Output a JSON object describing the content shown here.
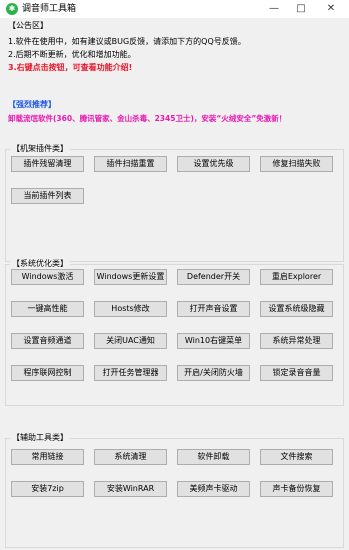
{
  "window": {
    "title": "调音师工具箱",
    "icon_glyph": "✱",
    "minimize": "—",
    "maximize": "□",
    "close": "✕"
  },
  "notice": {
    "header": "【公告区】",
    "line1": "1.软件在使用中，如有建议或BUG反馈，请添加下方的QQ号反馈。",
    "line2": "2.后期不断更新，优化和增加功能。",
    "line3": "3.右键点击按钮，可查看功能介绍!",
    "recommend_header": "【强烈推荐】",
    "recommend_text": "卸载流氓软件(360、腾讯管家、金山杀毒、2345卫士)，安装“火绒安全”免激新！"
  },
  "plugins": {
    "title": "【机架插件类】",
    "buttons": [
      "插件残留清理",
      "插件扫描重置",
      "设置优先级",
      "修复扫描失败",
      "当前插件列表"
    ]
  },
  "system": {
    "title": "【系统优化类】",
    "buttons": [
      "Windows激活",
      "Windows更新设置",
      "Defender开关",
      "重启Explorer",
      "一键高性能",
      "Hosts修改",
      "打开声音设置",
      "设置系统级隐藏",
      "设置音频通道",
      "关闭UAC通知",
      "Win10右键菜单",
      "系统异常处理",
      "程序联网控制",
      "打开任务管理器",
      "开启/关闭防火墙",
      "锁定录音音量"
    ]
  },
  "tools": {
    "title": "【辅助工具类】",
    "buttons": [
      "常用链接",
      "系统清理",
      "软件卸载",
      "文件搜索",
      "安装7zip",
      "安装WinRAR",
      "美频声卡驱动",
      "声卡备份恢复"
    ]
  },
  "colors": {
    "red_text": "#e8162b",
    "blue_text": "#1f57e8",
    "magenta_text": "#e81ab2",
    "app_icon": "#2bb24c"
  }
}
